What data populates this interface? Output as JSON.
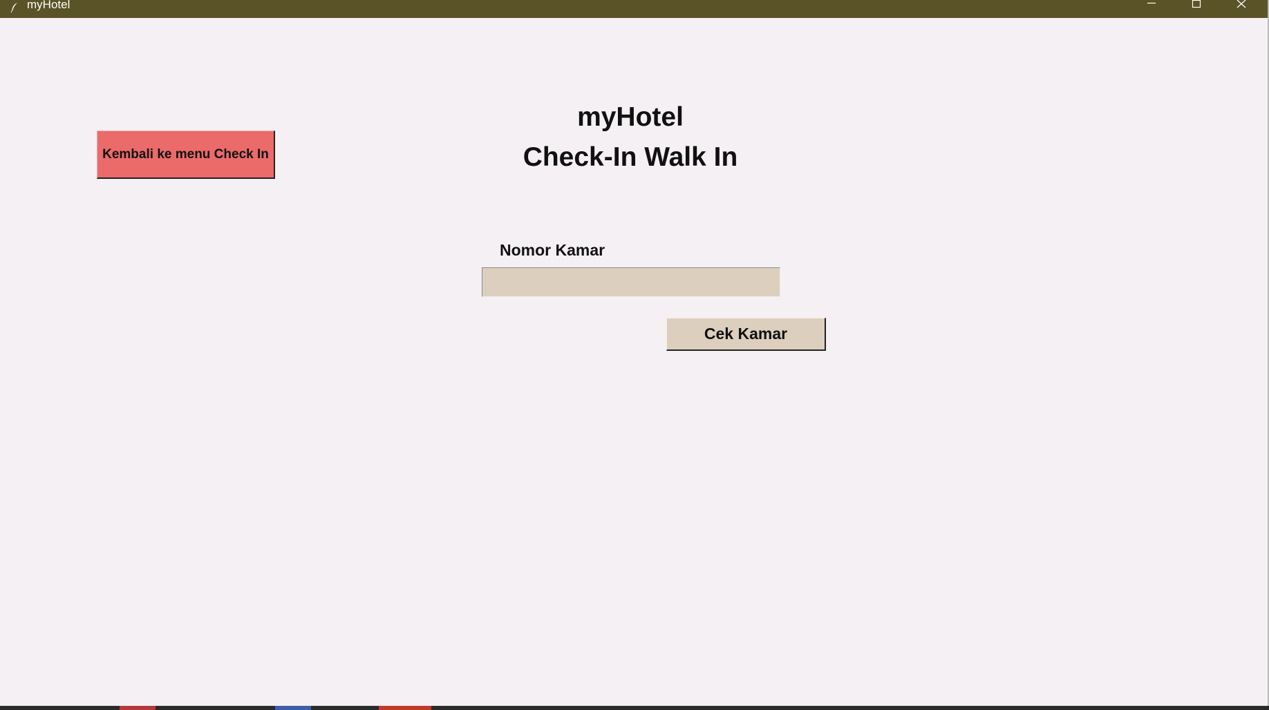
{
  "window": {
    "title": "myHotel",
    "controls": {
      "minimize_icon": "minimize-icon",
      "maximize_icon": "maximize-icon",
      "close_icon": "close-icon"
    }
  },
  "header": {
    "app_title": "myHotel",
    "page_subtitle": "Check-In Walk In"
  },
  "navigation": {
    "back_label": "Kembali ke menu Check In"
  },
  "form": {
    "room_number_label": "Nomor Kamar",
    "room_number_value": "",
    "check_button_label": "Cek Kamar"
  },
  "colors": {
    "titlebar": "#5a5327",
    "background": "#f4f0f3",
    "back_button": "#eb6a6a",
    "input_and_button": "#dccfbe"
  }
}
